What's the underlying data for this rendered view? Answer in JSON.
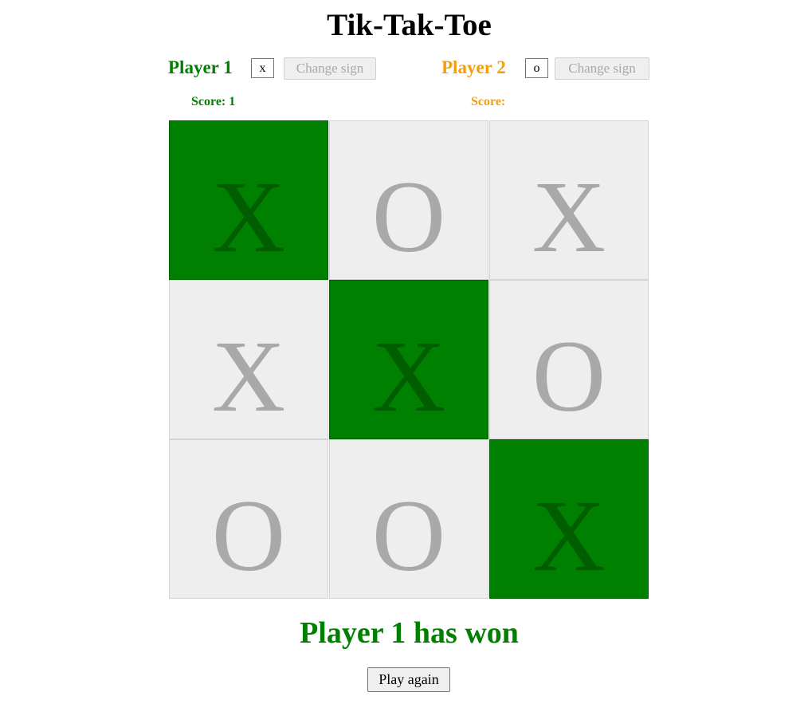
{
  "title": "Tik-Tak-Toe",
  "players": [
    {
      "name": "Player 1",
      "sign": "x",
      "change_label": "Change sign",
      "score_label": "Score: 1",
      "color": "#008000"
    },
    {
      "name": "Player 2",
      "sign": "o",
      "change_label": "Change sign",
      "score_label": "Score:",
      "color": "#f59e0b"
    }
  ],
  "board": {
    "cells": [
      {
        "mark": "X",
        "winning": true
      },
      {
        "mark": "O",
        "winning": false
      },
      {
        "mark": "X",
        "winning": false
      },
      {
        "mark": "X",
        "winning": false
      },
      {
        "mark": "X",
        "winning": true
      },
      {
        "mark": "O",
        "winning": false
      },
      {
        "mark": "O",
        "winning": false
      },
      {
        "mark": "O",
        "winning": false
      },
      {
        "mark": "X",
        "winning": true
      }
    ],
    "colors": {
      "cell_bg": "#eeeeee",
      "mark": "#a9a9a9",
      "win_bg": "#008000",
      "win_mark": "#005d00"
    }
  },
  "status": "Player 1 has won",
  "play_again_label": "Play again"
}
